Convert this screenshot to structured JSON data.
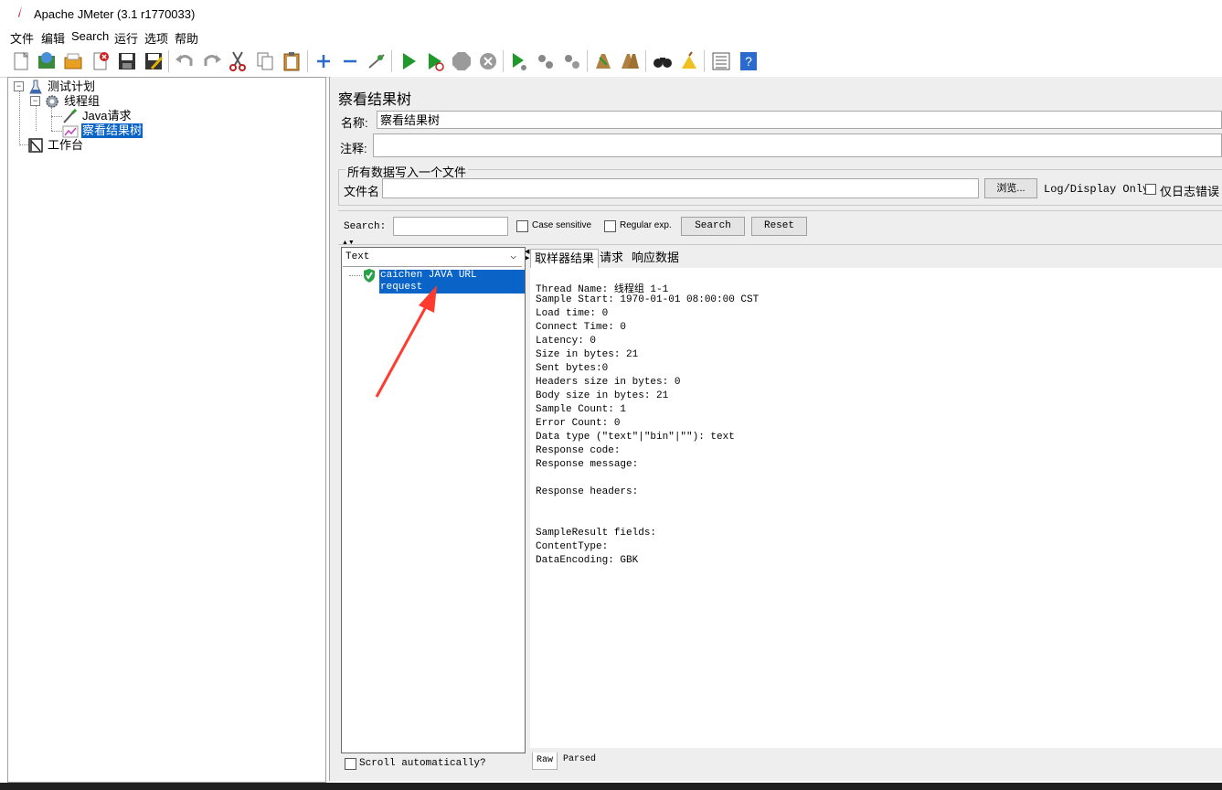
{
  "window": {
    "title": "Apache JMeter (3.1 r1770033)"
  },
  "menu": [
    "文件",
    "编辑",
    "Search",
    "运行",
    "选项",
    "帮助"
  ],
  "toolbar": {
    "icons": [
      "new-icon",
      "templates-icon",
      "open-icon",
      "close-icon",
      "save-icon",
      "save-as-icon",
      "undo-icon",
      "redo-icon",
      "cut-icon",
      "copy-icon",
      "paste-icon",
      "expand-icon",
      "collapse-icon",
      "toggle-icon",
      "start-icon",
      "start-no-pause-icon",
      "stop-icon",
      "shutdown-icon",
      "remote-start-icon",
      "remote-stop-icon",
      "remote-shutdown-icon",
      "clear-icon",
      "clear-all-icon",
      "search-icon",
      "reset-search-icon",
      "function-helper-icon",
      "help-icon"
    ]
  },
  "tree": {
    "items": [
      {
        "label": "测试计划"
      },
      {
        "label": "线程组"
      },
      {
        "label": "Java请求"
      },
      {
        "label": "察看结果树"
      },
      {
        "label": "工作台"
      }
    ]
  },
  "panel": {
    "title": "察看结果树",
    "name_label": "名称:",
    "name_value": "察看结果树",
    "comment_label": "注释:",
    "comment_value": "",
    "file_group_title": "所有数据写入一个文件",
    "filename_label": "文件名",
    "filename_value": "",
    "browse_label": "浏览...",
    "log_display_label": "Log/Display Only:",
    "errors_only_label": "仅日志错误"
  },
  "search": {
    "label": "Search:",
    "value": "",
    "case_sensitive_label": "Case sensitive",
    "regex_label": "Regular exp.",
    "search_button": "Search",
    "reset_button": "Reset"
  },
  "results": {
    "renderer": "Text",
    "sample_label": "caichen JAVA URL request",
    "scroll_auto_label": "Scroll automatically?",
    "tabs": [
      "取样器结果",
      "请求",
      "响应数据"
    ],
    "detail_lines": [
      "Thread Name: 线程组 1-1",
      "Sample Start: 1970-01-01 08:00:00 CST",
      "Load time: 0",
      "Connect Time: 0",
      "Latency: 0",
      "Size in bytes: 21",
      "Sent bytes:0",
      "Headers size in bytes: 0",
      "Body size in bytes: 21",
      "Sample Count: 1",
      "Error Count: 0",
      "Data type (\"text\"|\"bin\"|\"\"): text",
      "Response code:",
      "Response message:",
      "",
      "Response headers:",
      "",
      "",
      "SampleResult fields:",
      "ContentType:",
      "DataEncoding: GBK"
    ],
    "bottom_tabs": [
      "Raw",
      "Parsed"
    ]
  }
}
